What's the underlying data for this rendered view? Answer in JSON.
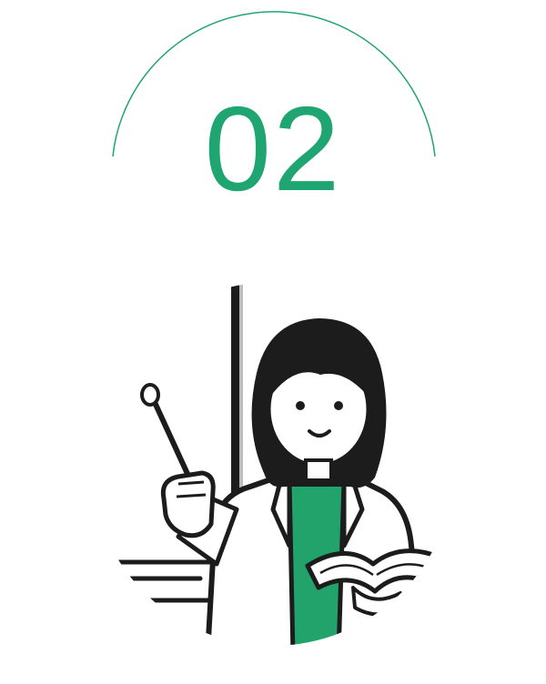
{
  "step": {
    "number": "02"
  },
  "colors": {
    "accent": "#1fa571",
    "ink": "#1c1c1c",
    "paper": "#ffffff",
    "shirt": "#22a36b"
  },
  "illustration": {
    "subject": "teacher-with-pointer-and-book-icon"
  }
}
